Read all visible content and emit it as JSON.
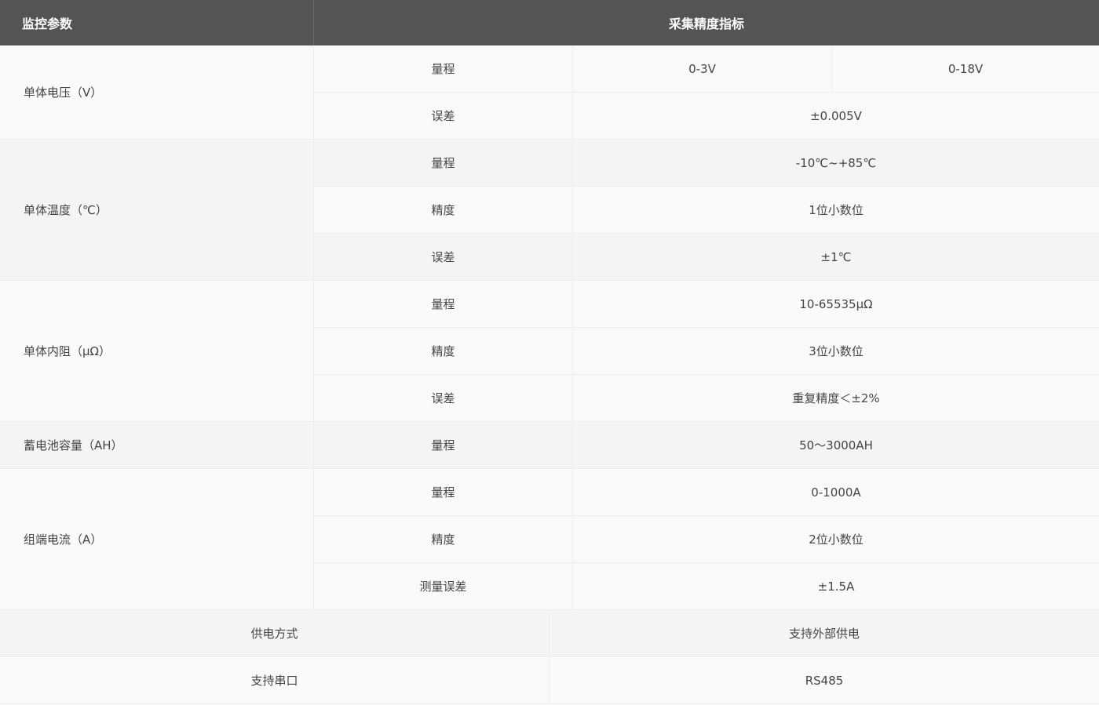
{
  "header": {
    "col_param": "监控参数",
    "col_spec": "采集精度指标"
  },
  "groups": {
    "voltage": {
      "name": "单体电压（V）",
      "range_label": "量程",
      "range_a": "0-3V",
      "range_b": "0-18V",
      "error_label": "误差",
      "error_value": "±0.005V"
    },
    "temperature": {
      "name": "单体温度（℃）",
      "range_label": "量程",
      "range_value": "-10℃~+85℃",
      "precision_label": "精度",
      "precision_value": "1位小数位",
      "error_label": "误差",
      "error_value": "±1℃"
    },
    "resistance": {
      "name": "单体内阻（μΩ）",
      "range_label": "量程",
      "range_value": "10-65535μΩ",
      "precision_label": "精度",
      "precision_value": "3位小数位",
      "error_label": "误差",
      "error_value": "重复精度＜±2%"
    },
    "capacity": {
      "name": "蓄电池容量（AH）",
      "range_label": "量程",
      "range_value": "50～3000AH"
    },
    "current": {
      "name": "组端电流（A）",
      "range_label": "量程",
      "range_value": "0-1000A",
      "precision_label": "精度",
      "precision_value": "2位小数位",
      "error_label": "测量误差",
      "error_value": "±1.5A"
    }
  },
  "footer_rows": {
    "power": {
      "label": "供电方式",
      "value": "支持外部供电"
    },
    "serial": {
      "label": "支持串口",
      "value": "RS485"
    }
  },
  "colors": {
    "header_bg": "#545454",
    "header_text": "#ffffff",
    "row_light": "#fafafa",
    "row_shade": "#f4f4f4",
    "border": "#eeeeee"
  }
}
